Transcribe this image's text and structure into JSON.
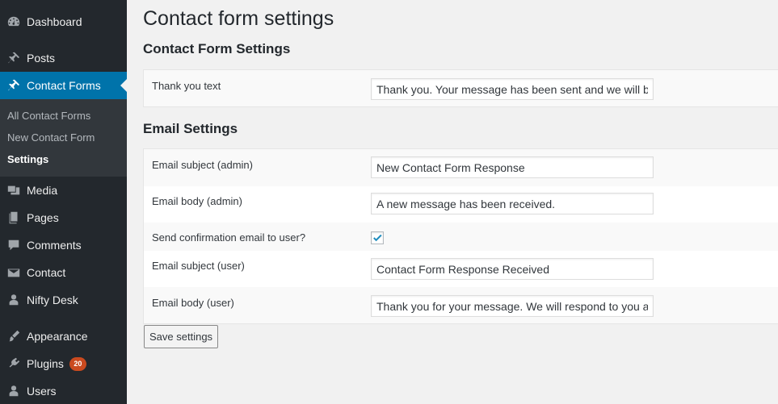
{
  "sidebar": {
    "items": [
      {
        "name": "dashboard",
        "label": "Dashboard",
        "icon": "dashboard-icon"
      },
      {
        "name": "posts",
        "label": "Posts",
        "icon": "pin-icon"
      },
      {
        "name": "contact-forms",
        "label": "Contact Forms",
        "icon": "pin-icon",
        "current": true
      },
      {
        "name": "media",
        "label": "Media",
        "icon": "media-icon"
      },
      {
        "name": "pages",
        "label": "Pages",
        "icon": "pages-icon"
      },
      {
        "name": "comments",
        "label": "Comments",
        "icon": "comment-icon"
      },
      {
        "name": "contact",
        "label": "Contact",
        "icon": "email-icon"
      },
      {
        "name": "nifty-desk",
        "label": "Nifty Desk",
        "icon": "user-icon"
      },
      {
        "name": "appearance",
        "label": "Appearance",
        "icon": "paintbrush-icon"
      },
      {
        "name": "plugins",
        "label": "Plugins",
        "icon": "plugin-icon",
        "badge": "20"
      },
      {
        "name": "users",
        "label": "Users",
        "icon": "users-icon"
      }
    ],
    "submenu": [
      {
        "label": "All Contact Forms"
      },
      {
        "label": "New Contact Form"
      },
      {
        "label": "Settings",
        "active": true
      }
    ]
  },
  "page": {
    "title": "Contact form settings",
    "contact_section_title": "Contact Form Settings",
    "email_section_title": "Email Settings",
    "save_label": "Save settings"
  },
  "fields": {
    "thank_you": {
      "label": "Thank you text",
      "value": "Thank you. Your message has been sent and we will be"
    },
    "email_subject_admin": {
      "label": "Email subject (admin)",
      "value": "New Contact Form Response"
    },
    "email_body_admin": {
      "label": "Email body (admin)",
      "value": "A new message has been received."
    },
    "send_confirmation": {
      "label": "Send confirmation email to user?",
      "checked": true
    },
    "email_subject_user": {
      "label": "Email subject (user)",
      "value": "Contact Form Response Received"
    },
    "email_body_user": {
      "label": "Email body (user)",
      "value": "Thank you for your message. We will respond to you as"
    }
  },
  "colors": {
    "sidebar_bg": "#23282d",
    "submenu_bg": "#32373c",
    "accent": "#0073aa",
    "badge": "#ca4a1f",
    "check": "#1e8cbe"
  }
}
